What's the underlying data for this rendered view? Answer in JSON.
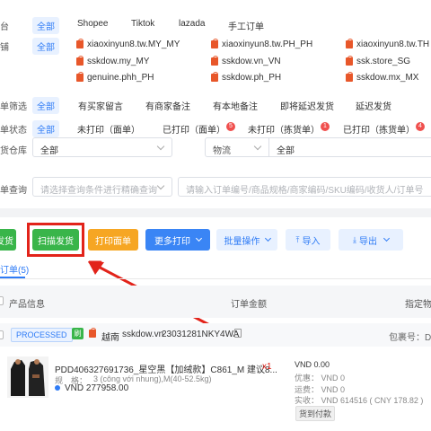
{
  "filters": {
    "platform": {
      "label": "台",
      "options": [
        "全部",
        "Shopee",
        "Tiktok",
        "lazada",
        "手工订单"
      ]
    },
    "store": {
      "label": "铺",
      "all": "全部",
      "shops": [
        "xiaoxinyun8.tw.MY_MY",
        "xiaoxinyun8.tw.PH_PH",
        "xiaoxinyun8.tw.TH",
        "sskdow.my_MY",
        "sskdow.vn_VN",
        "ssk.store_SG",
        "genuine.phh_PH",
        "sskdow.ph_PH",
        "sskdow.mx_MX"
      ]
    },
    "order_filter": {
      "label": "单筛选",
      "options": [
        "全部",
        "有买家留言",
        "有商家备注",
        "有本地备注",
        "即将延迟发货",
        "延迟发货"
      ]
    },
    "order_status": {
      "label": "单状态",
      "options": [
        "全部",
        "未打印（面单）",
        "已打印（面单）",
        "未打印（拣货单）",
        "已打印（拣货单）"
      ],
      "badges": [
        "5",
        "1",
        "4"
      ]
    },
    "warehouse": {
      "label": "货仓库",
      "select_value": "全部",
      "logistics_label": "物流",
      "logistics_value": "全部"
    },
    "precise_search": {
      "label": "单查询",
      "placeholder": "请选择查询条件进行精确查询",
      "input_placeholder": "请输入订单编号/商品规格/商家编码/SKU编码/收货人/订单号"
    }
  },
  "toolbar": {
    "ship_label": "发货",
    "scan_ship_label": "扫描发货",
    "print_label": "打印面单",
    "more_print_label": "更多打印",
    "batch_label": "批量操作",
    "import_label": "导入",
    "export_label": "导出"
  },
  "tab": {
    "label": "订单(5)"
  },
  "table": {
    "col_product": "产品信息",
    "col_amount": "订单金额",
    "col_assign": "指定物"
  },
  "order": {
    "status": "PROCESSED",
    "tag": "刷",
    "country": "越南",
    "shop": "sskdow.vn",
    "order_no": "23031281NKY4WA",
    "package_label": "包裹号：DZT",
    "product_title": "PDD406327691736_星空黑【加绒款】C861_M 建议8...",
    "spec_label": "规　格：",
    "spec_value": "3 (công với nhung),M(40-52.5kg)",
    "price": "VND 277958.00",
    "qty": "x1",
    "amount_total": "VND 0.00",
    "discount": "优惠： VND 0",
    "shipping": "运费： VND 0",
    "received": "实收： VND 614516 ( CNY 178.82 )",
    "payment_tag": "货到付款"
  },
  "colors": {
    "accent": "#2f7cf6",
    "green": "#39b54a",
    "orange": "#f6a623",
    "blue": "#3a85f5",
    "highlight": "#e2231a",
    "badge": "#f0504e",
    "shop_icon": "#e8572a"
  }
}
